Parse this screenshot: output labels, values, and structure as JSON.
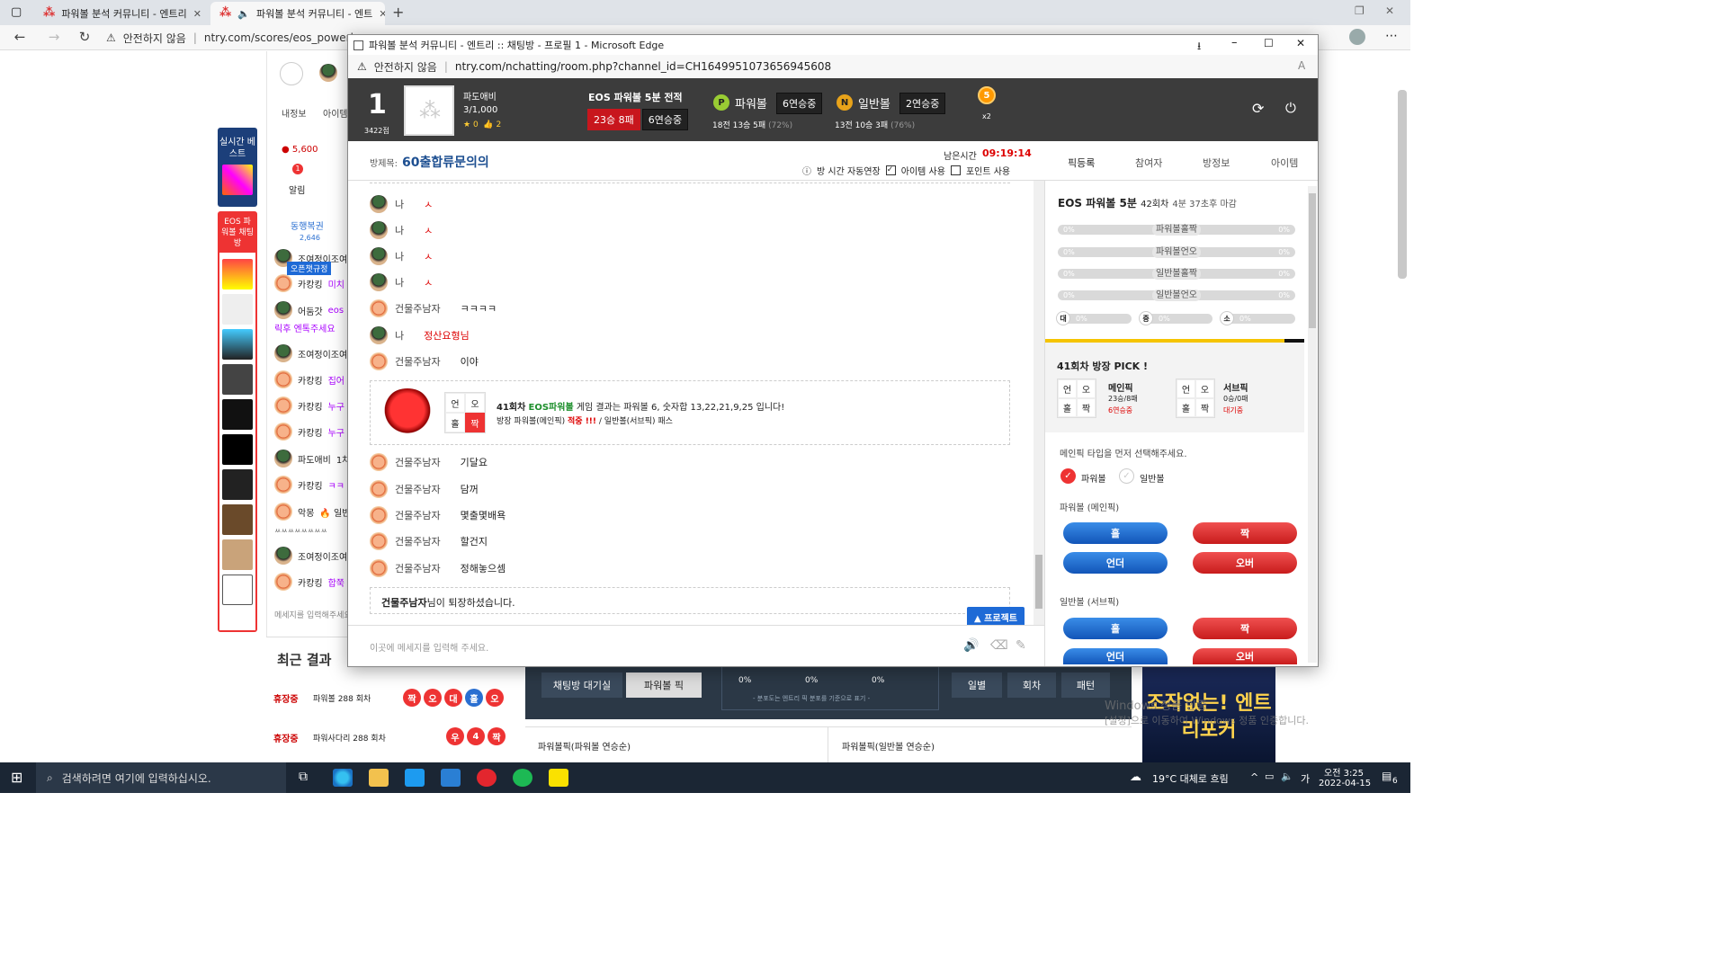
{
  "browser": {
    "tabs": [
      {
        "label": "파워볼 분석 커뮤니티 - 엔트리",
        "active": false
      },
      {
        "label": "파워볼 분석 커뮤니티 - 엔트",
        "active": true
      }
    ],
    "security": "안전하지 않음",
    "url": "ntry.com/scores/eos_powerb"
  },
  "bg": {
    "side1": "실시간 베스트",
    "side2": "EOS 파워볼 채팅방",
    "points": "5,600",
    "menu": [
      "내정보",
      "아이템"
    ],
    "alarm": "알림",
    "alarm_count": "1",
    "tab_label": "동행복권",
    "tab_count": "2,646",
    "notice": "오픈챗규정",
    "rows": [
      {
        "nick": "조여정이조여",
        "text": ""
      },
      {
        "nick": "카캉킹",
        "text": "미치"
      },
      {
        "nick": "어둠갓",
        "text": "eos"
      },
      {
        "nick": "",
        "text": "릭후 엔톡주세요"
      },
      {
        "nick": "조여정이조여",
        "text": ""
      },
      {
        "nick": "카캉킹",
        "text": "집어"
      },
      {
        "nick": "카캉킹",
        "text": "누구"
      },
      {
        "nick": "카캉킹",
        "text": "누구"
      },
      {
        "nick": "파도애비",
        "text": "1차"
      },
      {
        "nick": "카캉킹",
        "text": "ㅋㅋ"
      },
      {
        "nick": "악몽",
        "text": "🔥 일반"
      },
      {
        "nick": "",
        "text": "ㅆㅆㅆㅆㅆㅆㅆㅆ"
      },
      {
        "nick": "조여정이조여",
        "text": ""
      },
      {
        "nick": "카캉킹",
        "text": "합쭉"
      }
    ],
    "input_placeholder": "메세지를 입력해주세요",
    "recent_title": "최근 결과",
    "recent": [
      {
        "tag": "휴장중",
        "name": "파워볼 288 회차",
        "balls": [
          "짝",
          "오",
          "대",
          "홀",
          "오"
        ]
      },
      {
        "tag": "휴장중",
        "name": "파워사다리 288 회차",
        "balls": [
          "우",
          "4",
          "짝"
        ]
      }
    ],
    "waiting": "채팅방 대기실",
    "powerball_pick": "파워볼 픽",
    "pct": [
      "0%",
      "0%",
      "0%"
    ],
    "dist_note": "- 분포도는 엔트리 픽 분포를 기준으로 표기 -",
    "btns": [
      "일별",
      "회차",
      "패턴"
    ],
    "sec1": "파워볼픽(파워볼 연승순)",
    "sec2": "파워볼픽(일반볼 연승순)",
    "ad": "조작없는! 엔트리포커",
    "watermark1": "Windows 정품 인증",
    "watermark2": "[설정]으로 이동하여 Windows 정품 인증합니다."
  },
  "popup": {
    "title": "파워볼 분석 커뮤니티 - 엔트리 :: 채팅방 - 프로필 1 - Microsoft Edge",
    "security": "안전하지 않음",
    "url": "ntry.com/nchatting/room.php?channel_id=CH1649951073656945608",
    "rank": "1",
    "rank_pts": "3422점",
    "nick": "파도애비",
    "members": "3/1,000",
    "stars": "0",
    "likes": "2",
    "record_title": "EOS 파워볼 5분 전적",
    "record_win": "23승 8패",
    "record_streak": "6연승중",
    "pb_label": "파워볼",
    "pb_streak": "6연승중",
    "pb_stat": "18전 13승 5패",
    "pb_pct": "(72%)",
    "nb_label": "일반볼",
    "nb_streak": "2연승중",
    "nb_stat": "13전 10승 3패",
    "nb_pct": "(76%)",
    "medal": "5",
    "medal_x": "x2",
    "room_label": "방제목:",
    "room_title": "60출합류문의의",
    "remain_label": "남은시간",
    "remain": "09:19:14",
    "auto_extend": "방 시간 자동연장",
    "item_use": "아이템 사용",
    "point_use": "포인트 사용",
    "rtabs": [
      "픽등록",
      "참여자",
      "방정보",
      "아이템"
    ],
    "messages": [
      {
        "nick": "나",
        "text": "ㅅ",
        "color": "#d00",
        "ava": "soldier"
      },
      {
        "nick": "나",
        "text": "ㅅ",
        "color": "#d00",
        "ava": "soldier"
      },
      {
        "nick": "나",
        "text": "ㅅ",
        "color": "#d00",
        "ava": "soldier"
      },
      {
        "nick": "나",
        "text": "ㅅ",
        "color": "#d00",
        "ava": "soldier"
      },
      {
        "nick": "건물주남자",
        "text": "ㅋㅋㅋㅋ",
        "color": "#333",
        "ava": "new"
      },
      {
        "nick": "나",
        "text": "정산요형님",
        "color": "#d00",
        "ava": "soldier"
      },
      {
        "nick": "건물주남자",
        "text": "이야",
        "color": "#333",
        "ava": "new"
      }
    ],
    "sys": {
      "round": "41회차",
      "game": "EOS파워볼",
      "text": "게임 결과는 파워볼 6, 숫자합 13,22,21,9,25 입니다!",
      "line2a": "방장 파워볼(메인픽)",
      "hit": "적중 !!!",
      "line2b": "/ 일반볼(서브픽) 패스",
      "grid": [
        "언",
        "오",
        "홀",
        "짝"
      ]
    },
    "messages2": [
      {
        "nick": "건물주남자",
        "text": "기달요"
      },
      {
        "nick": "건물주남자",
        "text": "담꺼"
      },
      {
        "nick": "건물주남자",
        "text": "몇출몇배욕"
      },
      {
        "nick": "건물주남자",
        "text": "할건지"
      },
      {
        "nick": "건물주남자",
        "text": "정해놓으셈"
      }
    ],
    "left_nick": "건물주남자",
    "left_text": "님이 퇴장하셨습니다.",
    "protect": "▲ 프로젝트",
    "composer_placeholder": "이곳에 메세지를 입력해 주세요.",
    "rp_title": "EOS 파워볼 5분",
    "rp_round": "42회차",
    "rp_deadline": "4분 37초후 마감",
    "bars": [
      {
        "label": "파워볼홀짝",
        "l": "0%",
        "r": "0%"
      },
      {
        "label": "파워볼언오",
        "l": "0%",
        "r": "0%"
      },
      {
        "label": "일반볼홀짝",
        "l": "0%",
        "r": "0%"
      },
      {
        "label": "일반볼언오",
        "l": "0%",
        "r": "0%"
      }
    ],
    "small_bars": [
      {
        "ico": "대",
        "v": "0%"
      },
      {
        "ico": "중",
        "v": "0%"
      },
      {
        "ico": "소",
        "v": "0%"
      }
    ],
    "pick_title": "41회차 방장 PICK !",
    "main_pick": "메인픽",
    "main_rec": "23승/8패",
    "main_streak": "6연승중",
    "sub_pick": "서브픽",
    "sub_rec": "0승/0패",
    "sub_wait": "대기중",
    "pick_grid": [
      "언",
      "오",
      "홀",
      "짝"
    ],
    "select_prompt": "메인픽 타입을 먼저 선택해주세요.",
    "radio1": "파워볼",
    "radio2": "일반볼",
    "sec_main": "파워볼 (메인픽)",
    "sec_sub": "일반볼 (서브픽)",
    "btn_odd": "홀",
    "btn_even": "짝",
    "btn_under": "언더",
    "btn_over": "오버"
  },
  "taskbar": {
    "search": "검색하려면 여기에 입력하십시오.",
    "weather": "19°C 대체로 흐림",
    "time": "오전 3:25",
    "date": "2022-04-15",
    "ime": "가",
    "notif": "6"
  }
}
